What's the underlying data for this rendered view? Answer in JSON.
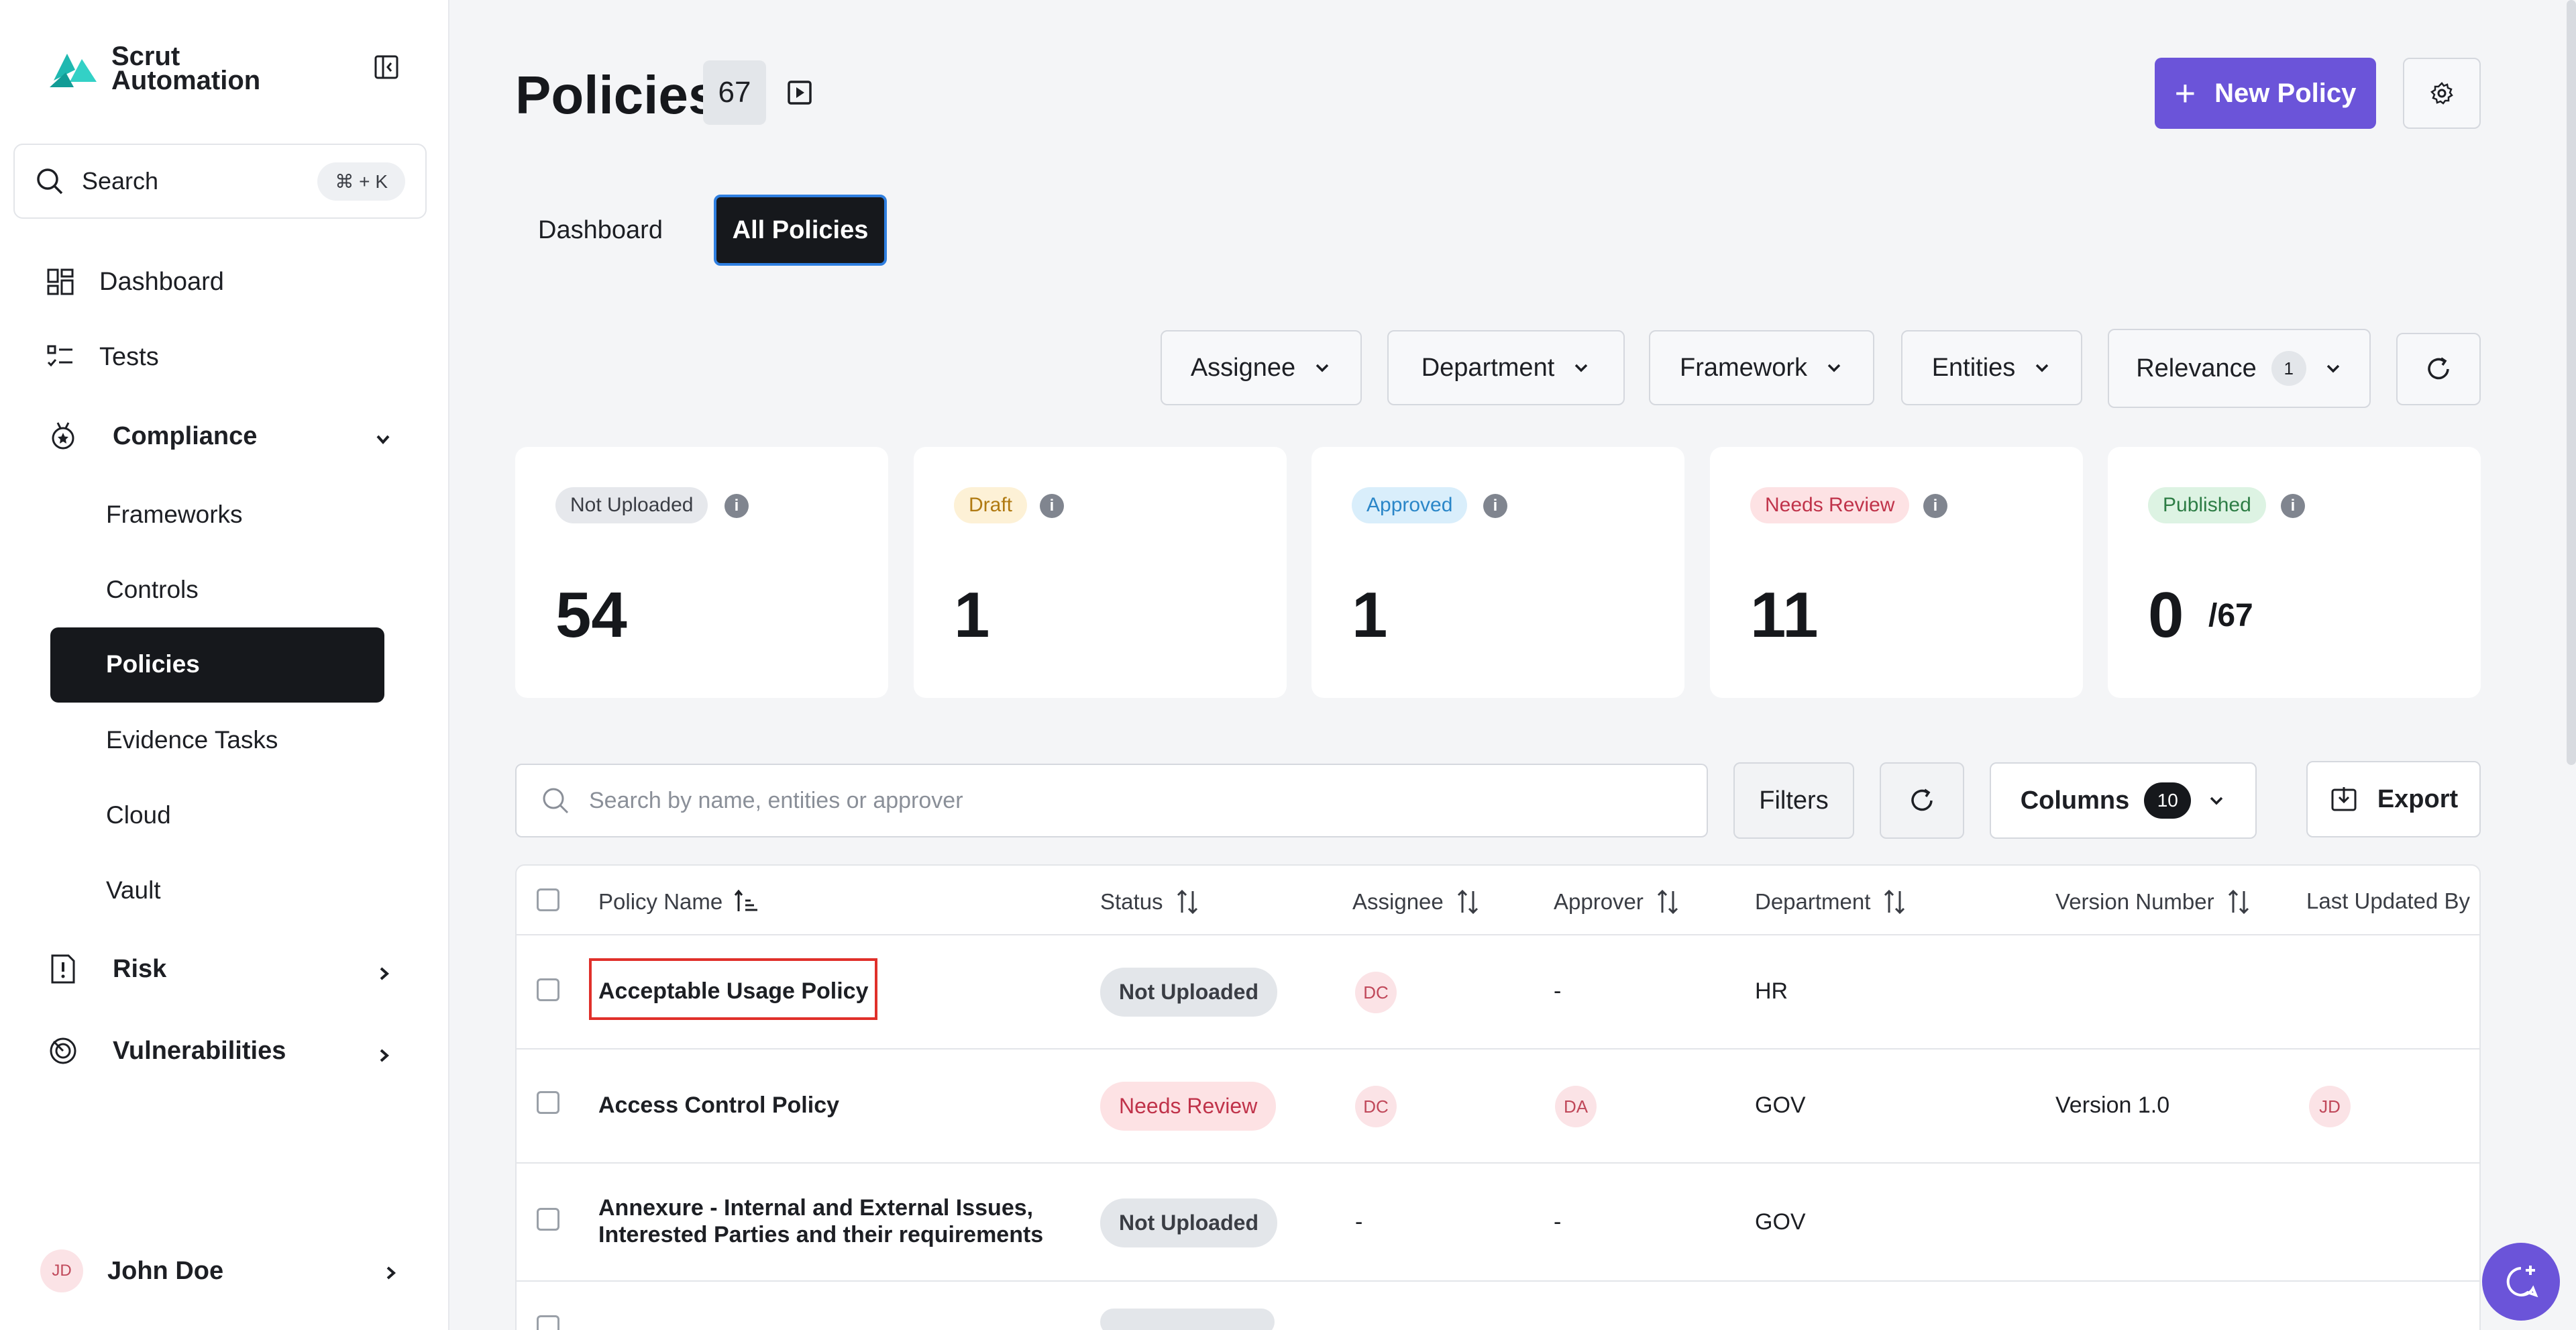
{
  "brand": {
    "line1": "Scrut",
    "line2": "Automation"
  },
  "sidebar": {
    "search_label": "Search",
    "search_shortcut": "⌘ + K",
    "items": [
      {
        "label": "Dashboard",
        "icon": "dashboard-icon"
      },
      {
        "label": "Tests",
        "icon": "tests-icon"
      },
      {
        "label": "Compliance",
        "icon": "compliance-icon"
      },
      {
        "label": "Risk",
        "icon": "risk-icon"
      },
      {
        "label": "Vulnerabilities",
        "icon": "vulnerabilities-icon"
      }
    ],
    "compliance_children": [
      "Frameworks",
      "Controls",
      "Policies",
      "Evidence Tasks",
      "Cloud",
      "Vault"
    ],
    "active": "Policies",
    "user": {
      "initials": "JD",
      "name": "John Doe"
    }
  },
  "header": {
    "title": "Policies",
    "count": "67",
    "new_button": "New Policy"
  },
  "tabs": [
    "Dashboard",
    "All Policies"
  ],
  "active_tab": "All Policies",
  "filters": {
    "assignee": "Assignee",
    "department": "Department",
    "framework": "Framework",
    "entities": "Entities",
    "relevance": "Relevance",
    "relevance_count": "1"
  },
  "stats": [
    {
      "label": "Not Uploaded",
      "value": "54",
      "bg": "#e6e8ec",
      "fg": "#3a3d44"
    },
    {
      "label": "Draft",
      "value": "1",
      "bg": "#fdf1d6",
      "fg": "#b07a12"
    },
    {
      "label": "Approved",
      "value": "1",
      "bg": "#d9eefb",
      "fg": "#2a86c8"
    },
    {
      "label": "Needs Review",
      "value": "11",
      "bg": "#fde2e4",
      "fg": "#c0334a"
    },
    {
      "label": "Published",
      "value": "0",
      "denominator": "/67",
      "bg": "#ddf3e3",
      "fg": "#2d7d45"
    }
  ],
  "table_toolbar": {
    "search_placeholder": "Search by name, entities or approver",
    "filters_label": "Filters",
    "columns_label": "Columns",
    "columns_count": "10",
    "export_label": "Export"
  },
  "table": {
    "headers": [
      "Policy Name",
      "Status",
      "Assignee",
      "Approver",
      "Department",
      "Version Number",
      "Last Updated By"
    ],
    "rows": [
      {
        "name": "Acceptable Usage Policy",
        "status": "Not Uploaded",
        "assignee": "DC",
        "approver": "-",
        "department": "HR",
        "version": "",
        "updated_by": ""
      },
      {
        "name": "Access Control Policy",
        "status": "Needs Review",
        "assignee": "DC",
        "approver": "DA",
        "department": "GOV",
        "version": "Version 1.0",
        "updated_by": "JD"
      },
      {
        "name_line1": "Annexure - Internal and External Issues,",
        "name_line2": "Interested Parties and their requirements",
        "status": "Not Uploaded",
        "assignee": "-",
        "approver": "-",
        "department": "GOV",
        "version": "",
        "updated_by": ""
      }
    ]
  },
  "colors": {
    "accent": "#6b54d9",
    "active_nav": "#16181c",
    "highlight": "#e0302a"
  }
}
